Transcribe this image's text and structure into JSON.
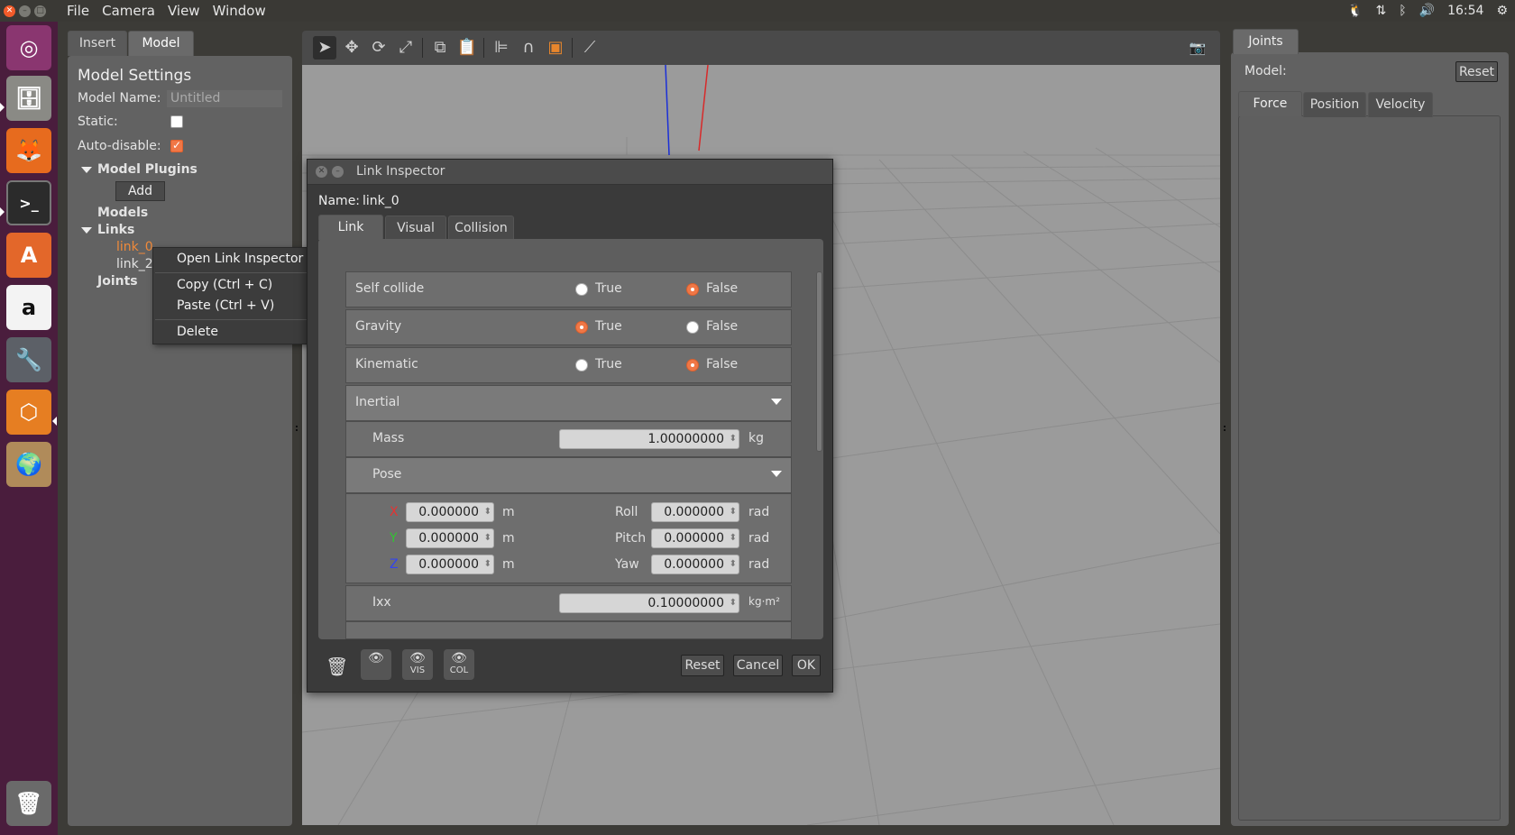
{
  "topbar": {
    "menus": [
      "File",
      "Camera",
      "View",
      "Window"
    ],
    "time": "16:54"
  },
  "launcher": {
    "icons": [
      "ubuntu-dash-icon",
      "files-icon",
      "firefox-icon",
      "terminal-icon",
      "software-center-icon",
      "amazon-icon",
      "system-settings-icon",
      "gazebo-icon",
      "archive-manager-icon",
      "trash-icon"
    ]
  },
  "left_panel": {
    "tabs": [
      "Insert",
      "Model"
    ],
    "active_tab": "Model",
    "title": "Model Settings",
    "model_name_label": "Model Name:",
    "model_name_value": "Untitled",
    "static_label": "Static:",
    "static_checked": false,
    "auto_disable_label": "Auto-disable:",
    "auto_disable_checked": true,
    "model_plugins_label": "Model Plugins",
    "add_button": "Add",
    "models_label": "Models",
    "links_label": "Links",
    "links": [
      "link_0",
      "link_2"
    ],
    "joints_label": "Joints"
  },
  "context_menu": {
    "items": [
      "Open Link Inspector",
      "Copy (Ctrl + C)",
      "Paste (Ctrl + V)",
      "Delete"
    ]
  },
  "link_inspector": {
    "title": "Link Inspector",
    "name_label": "Name:",
    "name_value": "link_0",
    "tabs": [
      "Link",
      "Visual",
      "Collision"
    ],
    "active_tab": "Link",
    "rows": {
      "self_collide": {
        "label": "Self collide",
        "true_label": "True",
        "false_label": "False",
        "value": "False"
      },
      "gravity": {
        "label": "Gravity",
        "true_label": "True",
        "false_label": "False",
        "value": "True"
      },
      "kinematic": {
        "label": "Kinematic",
        "true_label": "True",
        "false_label": "False",
        "value": "False"
      }
    },
    "inertial_label": "Inertial",
    "mass_label": "Mass",
    "mass_value": "1.00000000",
    "mass_unit": "kg",
    "pose_label": "Pose",
    "pose": {
      "x_label": "X",
      "x_value": "0.000000",
      "y_label": "Y",
      "y_value": "0.000000",
      "z_label": "Z",
      "z_value": "0.000000",
      "pos_unit": "m",
      "roll_label": "Roll",
      "roll_value": "0.000000",
      "pitch_label": "Pitch",
      "pitch_value": "0.000000",
      "yaw_label": "Yaw",
      "yaw_value": "0.000000",
      "rot_unit": "rad"
    },
    "ixx_label": "Ixx",
    "ixx_value": "0.10000000",
    "ixx_unit": "kg·m²",
    "vis_label": "VIS",
    "col_label": "COL",
    "reset_button": "Reset",
    "cancel_button": "Cancel",
    "ok_button": "OK"
  },
  "right_panel": {
    "tab": "Joints",
    "model_label": "Model:",
    "reset_button": "Reset",
    "subtabs": [
      "Force",
      "Position",
      "Velocity"
    ],
    "active_subtab": "Force"
  }
}
